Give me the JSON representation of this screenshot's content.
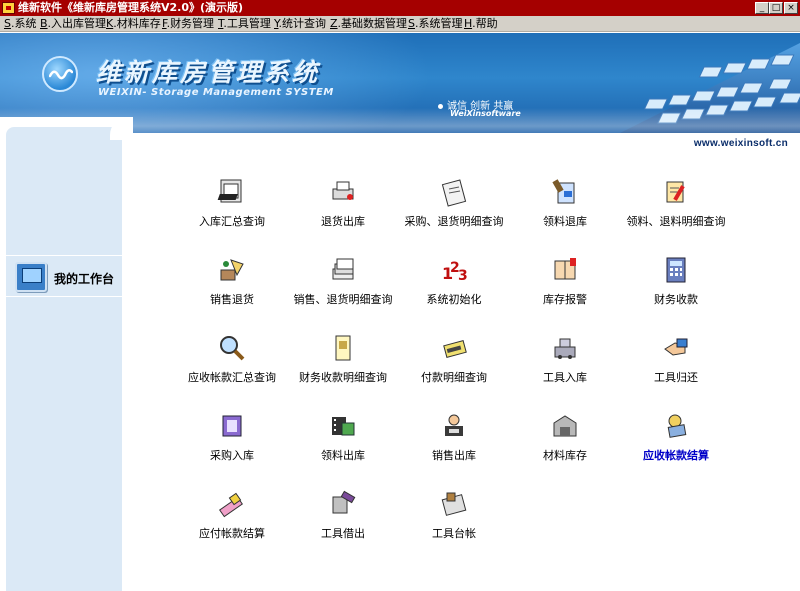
{
  "window": {
    "title": "维新软件《维新库房管理系统V2.0》(演示版)",
    "buttons": {
      "minimize": "_",
      "maximize": "□",
      "close": "×"
    }
  },
  "menubar": [
    {
      "key": "S",
      "label": "系统"
    },
    {
      "key": "B",
      "label": "入出库管理"
    },
    {
      "key": "K",
      "label": "材料库存"
    },
    {
      "key": "F",
      "label": "财务管理"
    },
    {
      "key": "T",
      "label": "工具管理"
    },
    {
      "key": "Y",
      "label": "统计查询"
    },
    {
      "key": "Z",
      "label": "基础数据管理"
    },
    {
      "key": "S",
      "label": "系统管理"
    },
    {
      "key": "H",
      "label": "帮助"
    }
  ],
  "banner": {
    "title": "维新库房管理系统",
    "subtitle": "WEIXIN- Storage Management SYSTEM",
    "slogan": "诚信 创新 共赢",
    "slogan_sub": "WeiXinsoftware"
  },
  "sidebar": {
    "workbench_label": "我的工作台"
  },
  "content": {
    "url": "www.weixinsoft.cn",
    "functions": [
      {
        "label": "入库汇总查询",
        "icon": "window-icon"
      },
      {
        "label": "退货出库",
        "icon": "printer-icon"
      },
      {
        "label": "采购、退货明细查询",
        "icon": "clipboard-icon"
      },
      {
        "label": "领料退库",
        "icon": "tools-doc-icon"
      },
      {
        "label": "领料、退料明细查询",
        "icon": "pencil-doc-icon"
      },
      {
        "label": "销售退货",
        "icon": "goods-return-icon"
      },
      {
        "label": "销售、退货明细查询",
        "icon": "stack-docs-icon"
      },
      {
        "label": "系统初始化",
        "icon": "numbers-icon"
      },
      {
        "label": "库存报警",
        "icon": "book-alarm-icon"
      },
      {
        "label": "财务收款",
        "icon": "calculator-icon"
      },
      {
        "label": "应收帐款汇总查询",
        "icon": "magnifier-icon"
      },
      {
        "label": "财务收款明细查询",
        "icon": "ledger-icon"
      },
      {
        "label": "付款明细查询",
        "icon": "payment-icon"
      },
      {
        "label": "工具入库",
        "icon": "machine-icon"
      },
      {
        "label": "工具归还",
        "icon": "hand-return-icon"
      },
      {
        "label": "采购入库",
        "icon": "purchase-icon"
      },
      {
        "label": "领料出库",
        "icon": "film-icon"
      },
      {
        "label": "销售出库",
        "icon": "sales-icon"
      },
      {
        "label": "材料库存",
        "icon": "warehouse-icon"
      },
      {
        "label": "应收帐款结算",
        "icon": "receivable-icon",
        "active": true
      },
      {
        "label": "应付帐款结算",
        "icon": "eraser-icon"
      },
      {
        "label": "工具借出",
        "icon": "lend-icon"
      },
      {
        "label": "工具台帐",
        "icon": "account-book-icon"
      }
    ]
  }
}
